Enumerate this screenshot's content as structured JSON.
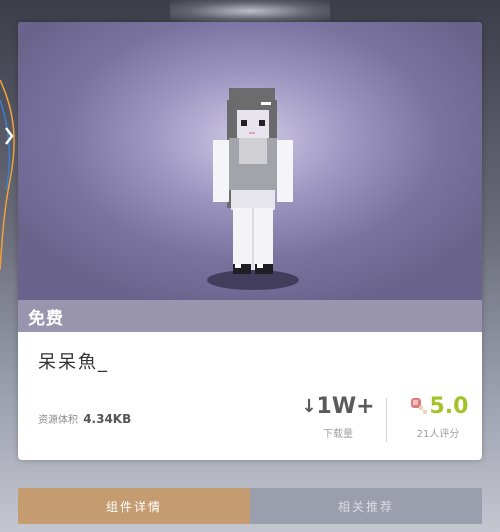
{
  "card": {
    "price_label": "免费",
    "title": "呆呆魚_",
    "size_label": "资源体积",
    "size_value": "4.34KB",
    "downloads_value": "1W+",
    "downloads_label": "下载量",
    "rating_value": "5.0",
    "rating_label": "21人评分",
    "icons": {
      "downloads": "download-arrow-icon",
      "rating": "meat-icon"
    }
  },
  "tabs": [
    {
      "label": "组件详情",
      "active": true
    },
    {
      "label": "相关推荐",
      "active": false
    }
  ],
  "colors": {
    "preview_bg": "#9c95c0",
    "price_bar": "#9995ae",
    "active_tab": "#c59b70",
    "inactive_tab": "#9a9ead",
    "rating_green": "#a3c428"
  }
}
